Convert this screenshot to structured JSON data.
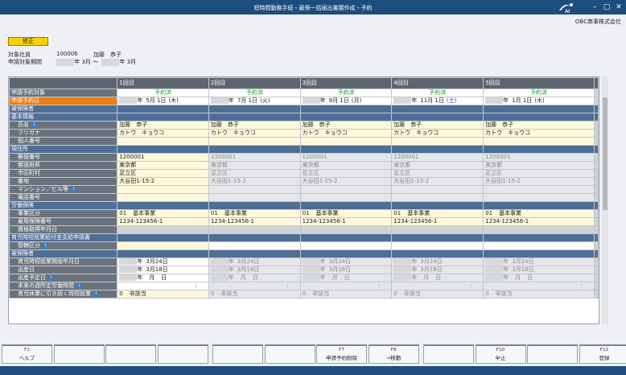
{
  "window": {
    "title": "短時間勤務手続・雇保一括届出書類作成・予約"
  },
  "company": "OBC商事株式会社",
  "status_badge": "修正",
  "employee": {
    "label": "対象社員",
    "code": "100006",
    "name": "加藤　恭子"
  },
  "period": {
    "label": "申請対象期間",
    "from_suffix": "年 3月 ～",
    "to_suffix": "年 3月"
  },
  "columns": [
    "1回目",
    "2回目",
    "3回目",
    "4回目",
    "5回目"
  ],
  "rows": {
    "apply_target": {
      "label": "申請予約対象",
      "values": [
        "予約済",
        "予約済",
        "予約済",
        "予約済",
        "予約済"
      ]
    },
    "apply_date": {
      "label": "申請予約日",
      "values": [
        {
          "y": "年",
          "md": "5月 1日",
          "dow": "(木)",
          "blue": false
        },
        {
          "y": "年",
          "md": "7月 1日",
          "dow": "(火)",
          "blue": false
        },
        {
          "y": "年",
          "md": "9月 1日",
          "dow": "(月)",
          "blue": false
        },
        {
          "y": "年",
          "md": "11月 1日",
          "dow": "(土)",
          "blue": true
        },
        {
          "y": "年",
          "md": "1月 1日",
          "dow": "(木)",
          "blue": false
        }
      ]
    },
    "insured_section": "被保険者",
    "basic_section": "基本情報",
    "name": {
      "label": "氏名",
      "value": "加藤　恭子"
    },
    "kana": {
      "label": "フリガナ",
      "value": "カトウ　キョウコ"
    },
    "personal_no": {
      "label": "個人番号"
    },
    "address_section": "現住所",
    "postal": {
      "label": "郵便番号",
      "value": "1200001"
    },
    "pref": {
      "label": "都道府県",
      "value": "東京都"
    },
    "city": {
      "label": "市区町村",
      "value": "足立区"
    },
    "street": {
      "label": "番地",
      "value": "大谷田1-15-2"
    },
    "building": {
      "label": "マンション／ビル等"
    },
    "phone": {
      "label": "電話番号"
    },
    "labor_section": "労働保険",
    "business": {
      "label": "事業区分",
      "code": "01",
      "name": "基本事業"
    },
    "emp_ins_no": {
      "label": "雇用保険番号",
      "value": "1234-123456-1"
    },
    "qualify_date": {
      "label": "資格取得年月日"
    },
    "childcare_section": "育児時短就業給付金支給申請書",
    "jurisdiction": {
      "label": "管轄区分"
    },
    "insured_section2": "被保険者",
    "childcare_start": {
      "label": "育児時短就業開始年月日",
      "y": "年",
      "md": "3月24日"
    },
    "birth": {
      "label": "出産日",
      "y": "年",
      "md": "3月18日"
    },
    "due": {
      "label": "出産予定日",
      "y": "年",
      "m": "月",
      "d": "日"
    },
    "scheduled_hours": {
      "label": "本来の週所定労働時間",
      "sep": ":"
    },
    "continued": {
      "label": "育児休業に引き続く時短就業",
      "code": "0",
      "value": "非該当"
    }
  },
  "fkeys": [
    {
      "key": "F1",
      "label": "ヘルプ"
    },
    {
      "key": "",
      "label": ""
    },
    {
      "key": "",
      "label": ""
    },
    {
      "key": "",
      "label": ""
    },
    {
      "key": "",
      "label": ""
    },
    {
      "key": "",
      "label": ""
    },
    {
      "key": "F7",
      "label": "申請予約削除"
    },
    {
      "key": "F8",
      "label": "→移動"
    },
    {
      "key": "",
      "label": ""
    },
    {
      "key": "F10",
      "label": "中止"
    },
    {
      "key": "",
      "label": ""
    },
    {
      "key": "F12",
      "label": "登録"
    }
  ],
  "colors": {
    "titlebar": "#1d4d7e",
    "selected_row": "#ea7f12",
    "section": "#4f6e96",
    "reserved_text": "#1a9b2a",
    "badge": "#f6d200"
  }
}
